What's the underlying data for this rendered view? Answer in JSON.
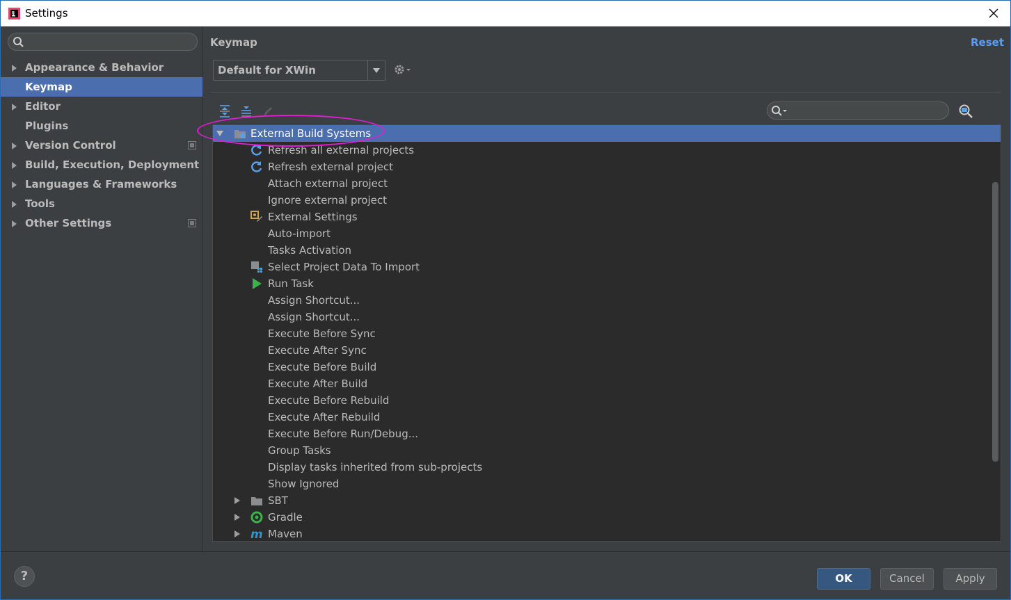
{
  "window": {
    "title": "Settings"
  },
  "sidebar": {
    "search_placeholder": "",
    "items": [
      {
        "label": "Appearance & Behavior",
        "expandable": true
      },
      {
        "label": "Keymap",
        "expandable": false,
        "selected": true
      },
      {
        "label": "Editor",
        "expandable": true
      },
      {
        "label": "Plugins",
        "expandable": false
      },
      {
        "label": "Version Control",
        "expandable": true,
        "project_icon": true
      },
      {
        "label": "Build, Execution, Deployment",
        "expandable": true
      },
      {
        "label": "Languages & Frameworks",
        "expandable": true
      },
      {
        "label": "Tools",
        "expandable": true
      },
      {
        "label": "Other Settings",
        "expandable": true,
        "project_icon": true
      }
    ]
  },
  "main": {
    "title": "Keymap",
    "reset_label": "Reset",
    "keymap_value": "Default for XWin",
    "tree_search_placeholder": ""
  },
  "tree": {
    "root": {
      "label": "External Build Systems",
      "expanded": true,
      "selected": true
    },
    "children": [
      {
        "label": "Refresh all external projects",
        "icon": "refresh-icon"
      },
      {
        "label": "Refresh external project",
        "icon": "refresh-icon"
      },
      {
        "label": "Attach external project",
        "icon": ""
      },
      {
        "label": "Ignore external project",
        "icon": ""
      },
      {
        "label": "External Settings",
        "icon": "settings-icon"
      },
      {
        "label": "Auto-import",
        "icon": ""
      },
      {
        "label": "Tasks Activation",
        "icon": ""
      },
      {
        "label": "Select Project Data To Import",
        "icon": "project-data-icon"
      },
      {
        "label": "Run Task",
        "icon": "run-icon"
      },
      {
        "label": "Assign Shortcut...",
        "icon": ""
      },
      {
        "label": "Assign Shortcut...",
        "icon": ""
      },
      {
        "label": "Execute Before Sync",
        "icon": ""
      },
      {
        "label": "Execute After Sync",
        "icon": ""
      },
      {
        "label": "Execute Before Build",
        "icon": ""
      },
      {
        "label": "Execute After Build",
        "icon": ""
      },
      {
        "label": "Execute Before Rebuild",
        "icon": ""
      },
      {
        "label": "Execute After Rebuild",
        "icon": ""
      },
      {
        "label": "Execute Before Run/Debug...",
        "icon": ""
      },
      {
        "label": "Group Tasks",
        "icon": ""
      },
      {
        "label": "Display tasks inherited from sub-projects",
        "icon": ""
      },
      {
        "label": "Show Ignored",
        "icon": ""
      }
    ],
    "groups": [
      {
        "label": "SBT",
        "icon": "folder-icon"
      },
      {
        "label": "Gradle",
        "icon": "gradle-icon"
      },
      {
        "label": "Maven",
        "icon": "maven-icon"
      }
    ]
  },
  "buttons": {
    "ok": "OK",
    "cancel": "Cancel",
    "apply": "Apply",
    "help": "?"
  },
  "colors": {
    "selection": "#4b6eaf",
    "link": "#589df6",
    "annotation": "#e11ed6"
  }
}
